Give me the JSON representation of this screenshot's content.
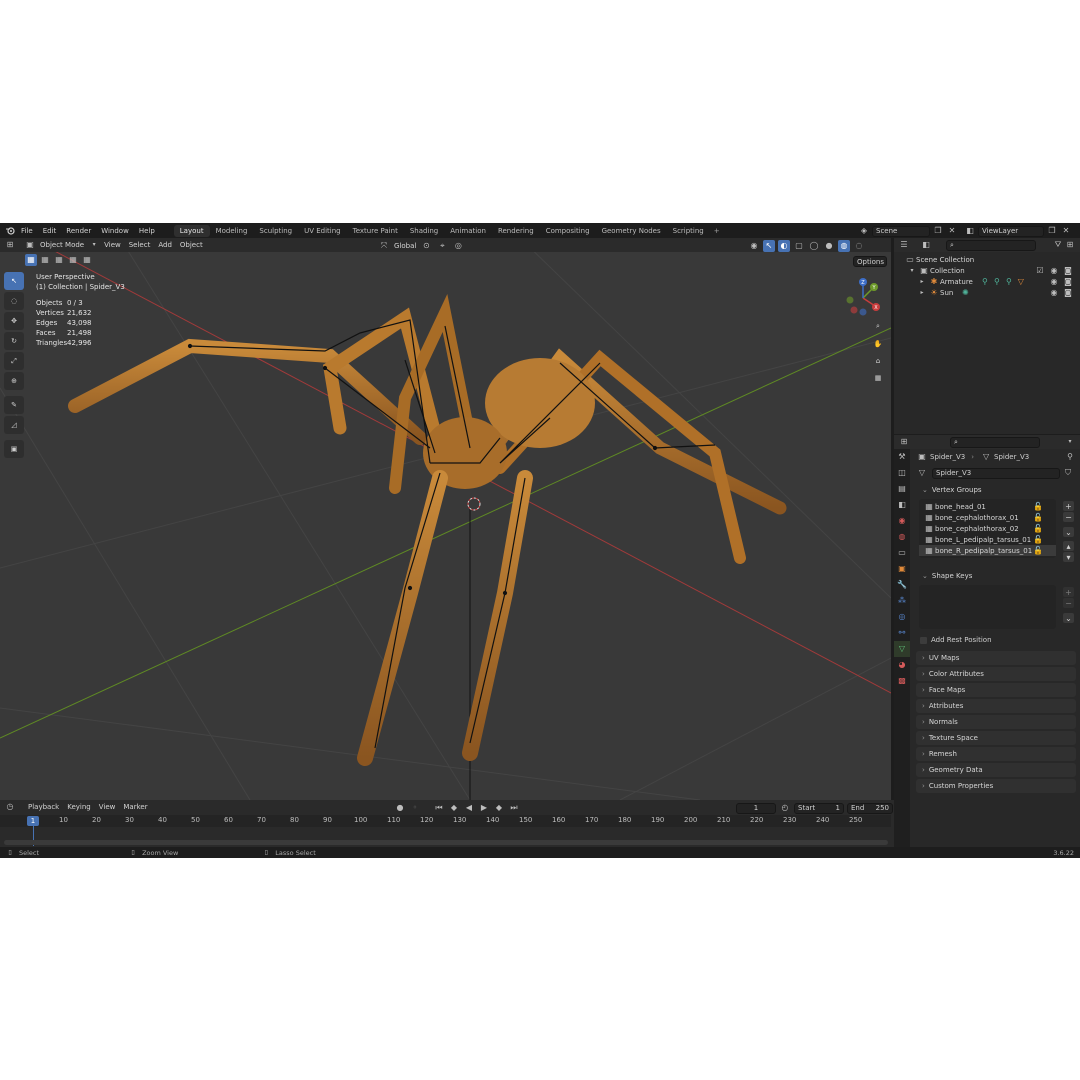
{
  "topbar": {
    "menus": [
      "File",
      "Edit",
      "Render",
      "Window",
      "Help"
    ],
    "workspaces": [
      "Layout",
      "Modeling",
      "Sculpting",
      "UV Editing",
      "Texture Paint",
      "Shading",
      "Animation",
      "Rendering",
      "Compositing",
      "Geometry Nodes",
      "Scripting"
    ],
    "active_workspace": "Layout",
    "scene_name": "Scene",
    "view_layer": "ViewLayer"
  },
  "viewport_header": {
    "mode": "Object Mode",
    "menus": [
      "View",
      "Select",
      "Add",
      "Object"
    ],
    "transform_orientation": "Global",
    "options_label": "Options"
  },
  "viewport_info": {
    "perspective": "User Perspective",
    "collection": "(1) Collection | Spider_V3",
    "stats": [
      {
        "label": "Objects",
        "value": "0 / 3"
      },
      {
        "label": "Vertices",
        "value": "21,632"
      },
      {
        "label": "Edges",
        "value": "43,098"
      },
      {
        "label": "Faces",
        "value": "21,498"
      },
      {
        "label": "Triangles",
        "value": "42,996"
      }
    ]
  },
  "tools": [
    "select-box-icon",
    "cursor-icon",
    "move-icon",
    "rotate-icon",
    "scale-icon",
    "transform-icon",
    "annotate-icon",
    "measure-icon",
    "add-cube-icon"
  ],
  "gizmo_axes": {
    "x": "X",
    "y": "Y",
    "z": "Z"
  },
  "timeline": {
    "menus": [
      "Playback",
      "Keying",
      "View",
      "Marker"
    ],
    "current_frame": "1",
    "start_label": "Start",
    "start_value": "1",
    "end_label": "End",
    "end_value": "250",
    "ticks": [
      "1",
      "10",
      "20",
      "30",
      "40",
      "50",
      "60",
      "70",
      "80",
      "90",
      "100",
      "110",
      "120",
      "130",
      "140",
      "150",
      "160",
      "170",
      "180",
      "190",
      "200",
      "210",
      "220",
      "230",
      "240",
      "250"
    ]
  },
  "status": {
    "select": "Select",
    "zoom": "Zoom View",
    "lasso": "Lasso Select",
    "version": "3.6.22"
  },
  "outliner": {
    "scene_collection": "Scene Collection",
    "collection": "Collection",
    "items": [
      "Armature",
      "Sun"
    ]
  },
  "properties": {
    "breadcrumb_object": "Spider_V3",
    "breadcrumb_data": "Spider_V3",
    "mesh_name": "Spider_V3",
    "vertex_groups_title": "Vertex Groups",
    "vertex_groups": [
      "bone_head_01",
      "bone_cephalothorax_01",
      "bone_cephalothorax_02",
      "bone_L_pedipalp_tarsus_01",
      "bone_R_pedipalp_tarsus_01"
    ],
    "shape_keys_title": "Shape Keys",
    "add_rest_position": "Add Rest Position",
    "panels": [
      "UV Maps",
      "Color Attributes",
      "Face Maps",
      "Attributes",
      "Normals",
      "Texture Space",
      "Remesh",
      "Geometry Data",
      "Custom Properties"
    ]
  },
  "colors": {
    "accent": "#4772b3",
    "viewport_bg": "#393939",
    "spider_body": "#b8782c",
    "x_axis": "#c83d3d",
    "y_axis": "#6e9a2a"
  }
}
